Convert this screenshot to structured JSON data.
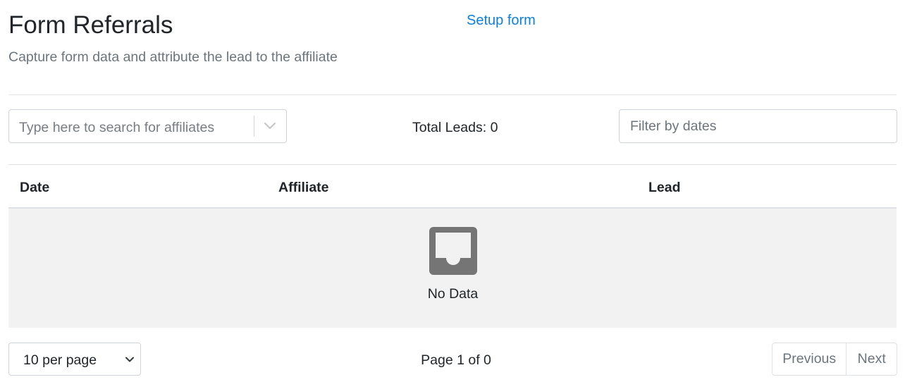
{
  "header": {
    "title": "Form Referrals",
    "setup_link": "Setup form",
    "subtitle": "Capture form data and attribute the lead to the affiliate"
  },
  "filters": {
    "affiliate_search": {
      "placeholder": "Type here to search for affiliates",
      "value": ""
    },
    "total_leads_label": "Total Leads: 0",
    "date_filter": {
      "placeholder": "Filter by dates",
      "value": ""
    }
  },
  "table": {
    "columns": [
      "Date",
      "Affiliate",
      "Lead"
    ],
    "rows": [],
    "empty_icon": "inbox-icon",
    "empty_text": "No Data"
  },
  "pagination": {
    "per_page_selected": "10 per page",
    "page_info": "Page 1 of 0",
    "previous_label": "Previous",
    "next_label": "Next"
  },
  "colors": {
    "link": "#0d7fe0",
    "muted_text": "#6c757d",
    "empty_row_bg": "#f2f2f2",
    "icon": "#757575"
  }
}
